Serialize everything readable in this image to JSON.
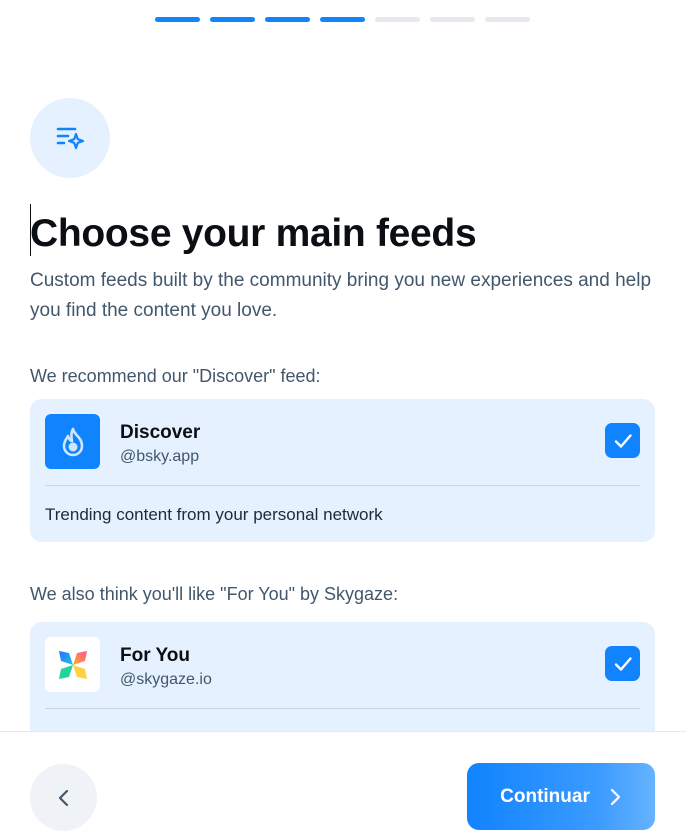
{
  "progress": {
    "total_steps": 7,
    "completed_steps": 4
  },
  "header": {
    "title": "Choose your main feeds",
    "subtitle": "Custom feeds built by the community bring you new experiences and help you find the content you love."
  },
  "recommended": {
    "label": "We recommend our \"Discover\" feed:",
    "feed": {
      "name": "Discover",
      "handle": "@bsky.app",
      "description": "Trending content from your personal network",
      "checked": true,
      "icon": "flame-icon"
    }
  },
  "also_like": {
    "label": "We also think you'll like \"For You\" by Skygaze:",
    "feed": {
      "name": "For You",
      "handle": "@skygaze.io",
      "checked": true,
      "icon": "skygaze-logo-icon"
    }
  },
  "footer": {
    "back_icon": "chevron-left-icon",
    "continue_label": "Continuar",
    "continue_icon": "chevron-right-icon"
  },
  "colors": {
    "accent": "#1083fe",
    "card_bg": "#e5f1ff",
    "muted_text": "#42576c"
  }
}
